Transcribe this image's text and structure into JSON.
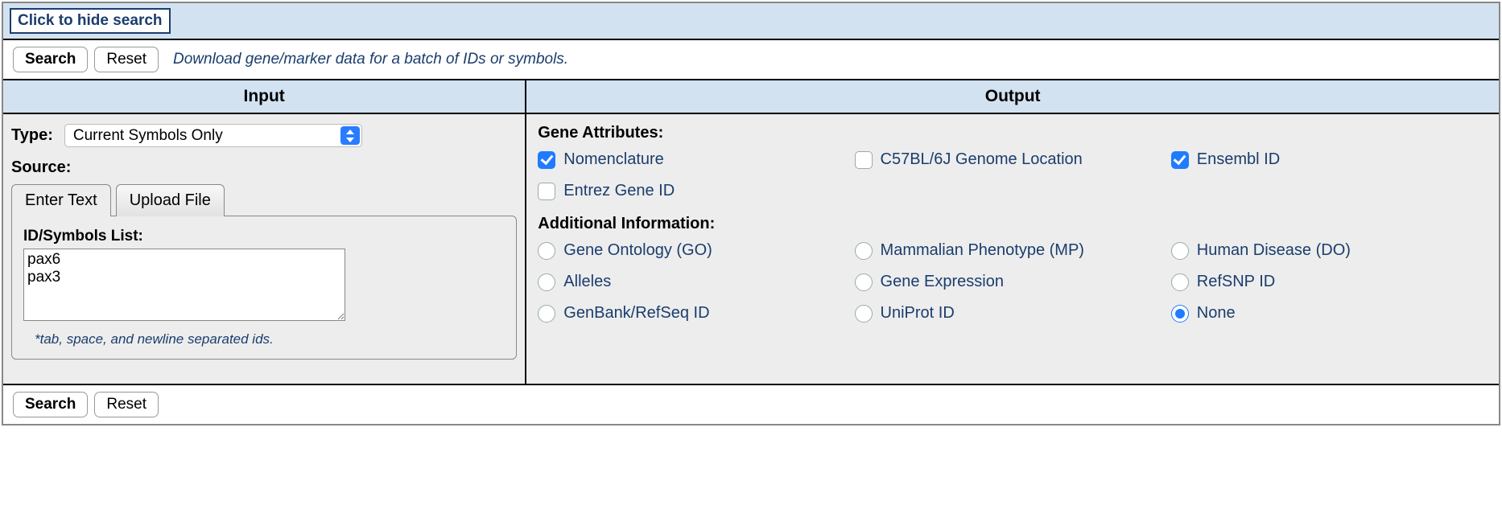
{
  "hide_search_label": "Click to hide search",
  "top": {
    "search_label": "Search",
    "reset_label": "Reset",
    "description": "Download gene/marker data for a batch of IDs or symbols."
  },
  "headers": {
    "input": "Input",
    "output": "Output"
  },
  "input": {
    "type_label": "Type:",
    "type_selected": "Current Symbols Only",
    "source_label": "Source:",
    "tabs": {
      "enter_text": "Enter Text",
      "upload_file": "Upload File",
      "active": "enter_text"
    },
    "ids_label": "ID/Symbols List:",
    "ids_value": "pax6\npax3",
    "ids_hint": "*tab, space, and newline separated ids."
  },
  "output": {
    "gene_attr_header": "Gene Attributes:",
    "gene_attrs": [
      {
        "id": "nomenclature",
        "label": "Nomenclature",
        "checked": true
      },
      {
        "id": "genome-location",
        "label": "C57BL/6J Genome Location",
        "checked": false
      },
      {
        "id": "ensembl-id",
        "label": "Ensembl ID",
        "checked": true
      },
      {
        "id": "entrez-gene-id",
        "label": "Entrez Gene ID",
        "checked": false
      }
    ],
    "addl_header": "Additional Information:",
    "addl": [
      {
        "id": "go",
        "label": "Gene Ontology (GO)"
      },
      {
        "id": "mp",
        "label": "Mammalian Phenotype (MP)"
      },
      {
        "id": "do",
        "label": "Human Disease (DO)"
      },
      {
        "id": "alleles",
        "label": "Alleles"
      },
      {
        "id": "expression",
        "label": "Gene Expression"
      },
      {
        "id": "refsnp",
        "label": "RefSNP ID"
      },
      {
        "id": "genbank",
        "label": "GenBank/RefSeq ID"
      },
      {
        "id": "uniprot",
        "label": "UniProt ID"
      },
      {
        "id": "none",
        "label": "None"
      }
    ],
    "addl_selected": "none"
  },
  "bottom": {
    "search_label": "Search",
    "reset_label": "Reset"
  }
}
